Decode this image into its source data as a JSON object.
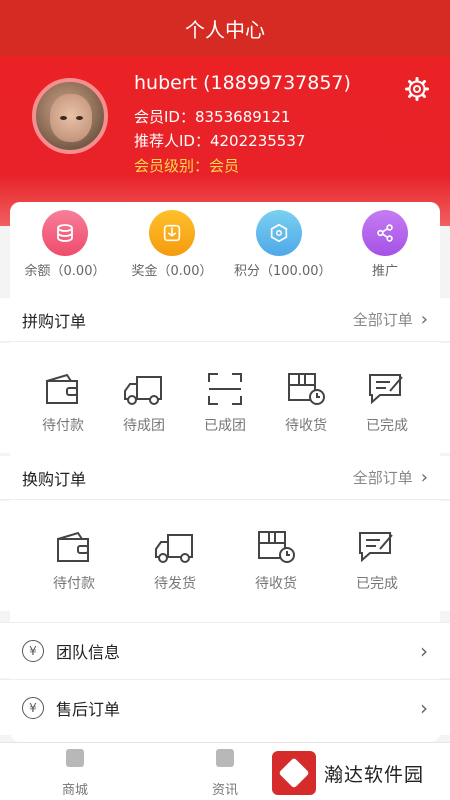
{
  "header": {
    "title": "个人中心"
  },
  "profile": {
    "username": "hubert (18899737857)",
    "member_id": "会员ID：8353689121",
    "referrer_id": "推荐人ID：4202235537",
    "member_level": "会员级别：会员"
  },
  "stats": [
    {
      "label": "余额（0.00）",
      "icon": "coins-icon",
      "color": "#ef4c6c"
    },
    {
      "label": "奖金（0.00）",
      "icon": "bonus-box-icon",
      "color": "#f59b10"
    },
    {
      "label": "积分（100.00）",
      "icon": "points-hexagon-icon",
      "color": "#4fa8e8"
    },
    {
      "label": "推广",
      "icon": "share-icon",
      "color": "#a552e6"
    }
  ],
  "group_orders": {
    "title": "拼购订单",
    "all_link": "全部订单",
    "items": [
      {
        "label": "待付款",
        "icon": "wallet-icon"
      },
      {
        "label": "待成团",
        "icon": "truck-icon"
      },
      {
        "label": "已成团",
        "icon": "scan-frame-icon"
      },
      {
        "label": "待收货",
        "icon": "package-clock-icon"
      },
      {
        "label": "已完成",
        "icon": "done-edit-icon"
      }
    ]
  },
  "exchange_orders": {
    "title": "换购订单",
    "all_link": "全部订单",
    "items": [
      {
        "label": "待付款",
        "icon": "wallet-icon"
      },
      {
        "label": "待发货",
        "icon": "truck-icon"
      },
      {
        "label": "待收货",
        "icon": "package-clock-icon"
      },
      {
        "label": "已完成",
        "icon": "done-edit-icon"
      }
    ]
  },
  "menu": [
    {
      "label": "团队信息",
      "icon": "yen-circle-icon"
    },
    {
      "label": "售后订单",
      "icon": "yen-circle-icon"
    }
  ],
  "tabbar": [
    {
      "label": "商城",
      "icon": "home-icon"
    },
    {
      "label": "资讯",
      "icon": "news-icon"
    }
  ],
  "watermark": {
    "text": "瀚达软件园"
  },
  "colors": {
    "primary": "#e82228",
    "level_text": "#ffd84a"
  }
}
